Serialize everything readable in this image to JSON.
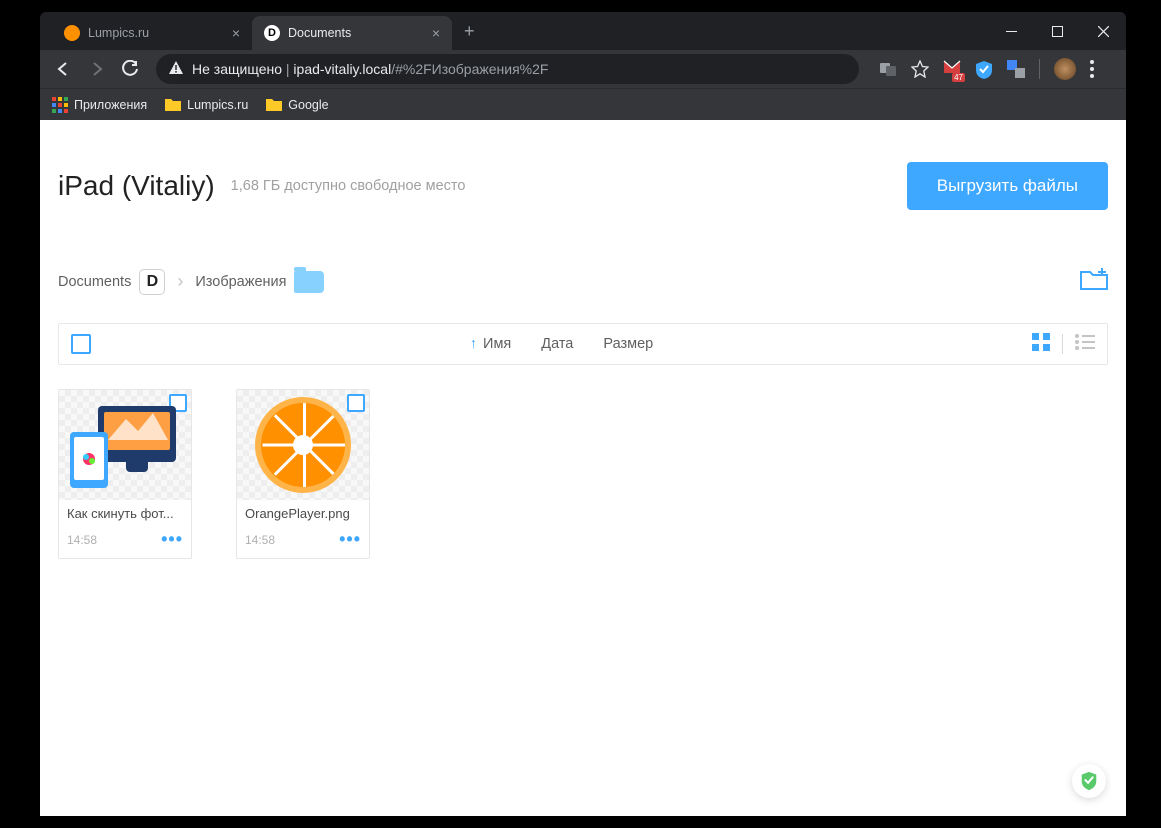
{
  "tabs": [
    {
      "title": "Lumpics.ru",
      "active": false,
      "favicon_color": "#ff9000"
    },
    {
      "title": "Documents",
      "active": true,
      "favicon_letter": "D"
    }
  ],
  "window_controls": {
    "minimize": "—",
    "maximize": "☐",
    "close": "✕"
  },
  "omnibox": {
    "not_secure_label": "Не защищено",
    "separator": " | ",
    "host": "ipad-vitaliy.local",
    "path": "/#%2FИзображения%2F"
  },
  "extensions": {
    "translate_icon": "translate-icon",
    "star_icon": "star-icon",
    "gmail_badge": "47",
    "shield_icon": "shield-icon",
    "google_translate_icon": "google-translate-icon",
    "avatar_icon": "avatar-icon",
    "menu_icon": "menu-icon"
  },
  "bookmarks": [
    {
      "label": "Приложения",
      "icon": "apps-icon"
    },
    {
      "label": "Lumpics.ru",
      "icon": "folder-icon"
    },
    {
      "label": "Google",
      "icon": "folder-icon"
    }
  ],
  "page": {
    "title": "iPad (Vitaliy)",
    "storage_text": "1,68 ГБ доступно свободное место",
    "upload_button": "Выгрузить файлы"
  },
  "breadcrumb": {
    "root": "Documents",
    "current": "Изображения",
    "app_letter": "D"
  },
  "sort": {
    "name_label": "Имя",
    "date_label": "Дата",
    "size_label": "Размер",
    "arrow": "↑"
  },
  "files": [
    {
      "name": "Как скинуть фот...",
      "time": "14:58"
    },
    {
      "name": "OrangePlayer.png",
      "time": "14:58"
    }
  ],
  "file_menu_dots": "•••"
}
